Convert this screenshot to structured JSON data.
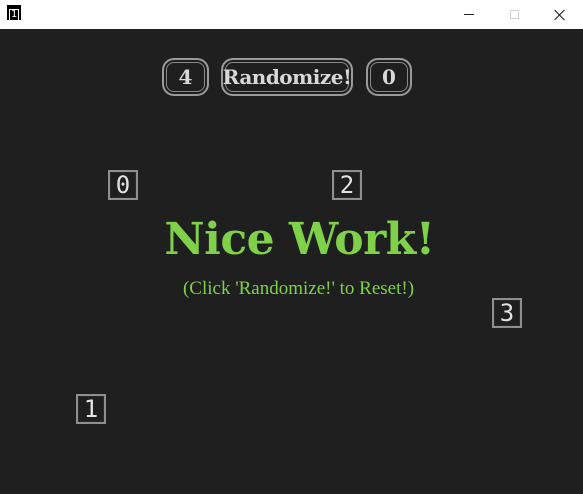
{
  "window": {
    "app_icon_glyph": "1",
    "icons": [
      "minimize-icon",
      "maximize-icon",
      "close-icon"
    ]
  },
  "toolbar": {
    "left_count": "4",
    "randomize_label": "Randomize!",
    "right_count": "0"
  },
  "tiles": [
    "0",
    "2",
    "3",
    "1"
  ],
  "message": {
    "headline": "Nice Work!",
    "subtext": "(Click 'Randomize!' to Reset!)"
  },
  "colors": {
    "background": "#1f1f1f",
    "accent_green": "#7fd14a",
    "border_gray": "#9a9a9a"
  }
}
